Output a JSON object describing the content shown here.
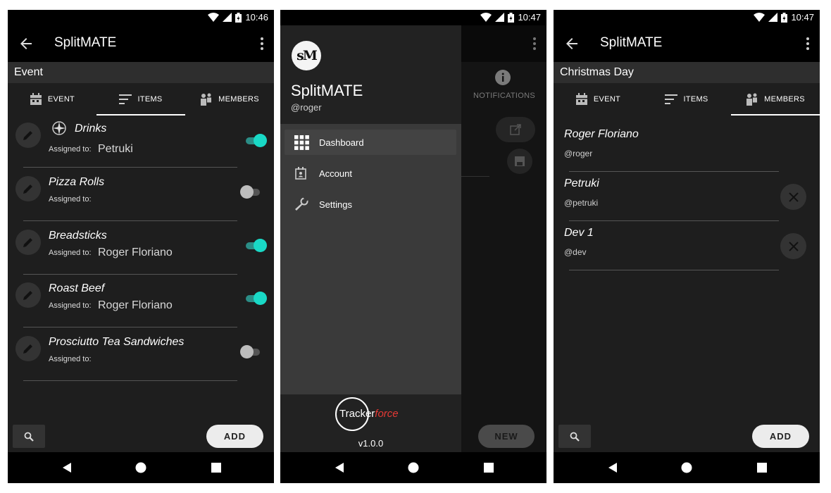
{
  "status": {
    "time1": "10:46",
    "time2": "10:47",
    "time3": "10:47"
  },
  "app": {
    "title": "SplitMATE"
  },
  "tabs": {
    "event": "EVENT",
    "items": "ITEMS",
    "members": "MEMBERS"
  },
  "screen1": {
    "event_name": "Event",
    "assigned_label": "Assigned to:",
    "items": [
      {
        "name": "Drinks",
        "assignee": "Petruki",
        "toggled": true
      },
      {
        "name": "Pizza Rolls",
        "assignee": "",
        "toggled": false
      },
      {
        "name": "Breadsticks",
        "assignee": "Roger Floriano",
        "toggled": true
      },
      {
        "name": "Roast Beef",
        "assignee": "Roger Floriano",
        "toggled": true
      },
      {
        "name": "Prosciutto Tea Sandwiches",
        "assignee": "",
        "toggled": false
      }
    ],
    "add_label": "ADD"
  },
  "screen2": {
    "drawer": {
      "logo_text": "sM",
      "name": "SplitMATE",
      "username": "@roger",
      "items": [
        {
          "label": "Dashboard",
          "icon": "grid-icon",
          "active": true
        },
        {
          "label": "Account",
          "icon": "account-icon",
          "active": false
        },
        {
          "label": "Settings",
          "icon": "wrench-icon",
          "active": false
        }
      ],
      "brand_part1": "Tracker",
      "brand_part2": "force",
      "version": "v1.0.0"
    },
    "background": {
      "notifications_label": "NOTIFICATIONS",
      "new_label": "NEW"
    }
  },
  "screen3": {
    "event_name": "Christmas Day",
    "members": [
      {
        "name": "Roger Floriano",
        "handle": "@roger",
        "removable": false
      },
      {
        "name": "Petruki",
        "handle": "@petruki",
        "removable": true
      },
      {
        "name": "Dev 1",
        "handle": "@dev",
        "removable": true
      }
    ],
    "add_label": "ADD"
  },
  "colors": {
    "accent": "#19d9c6",
    "background": "#1e1e1e",
    "appbar": "#000000",
    "drawer": "#3a3a3a",
    "brand_red": "#e53935"
  }
}
